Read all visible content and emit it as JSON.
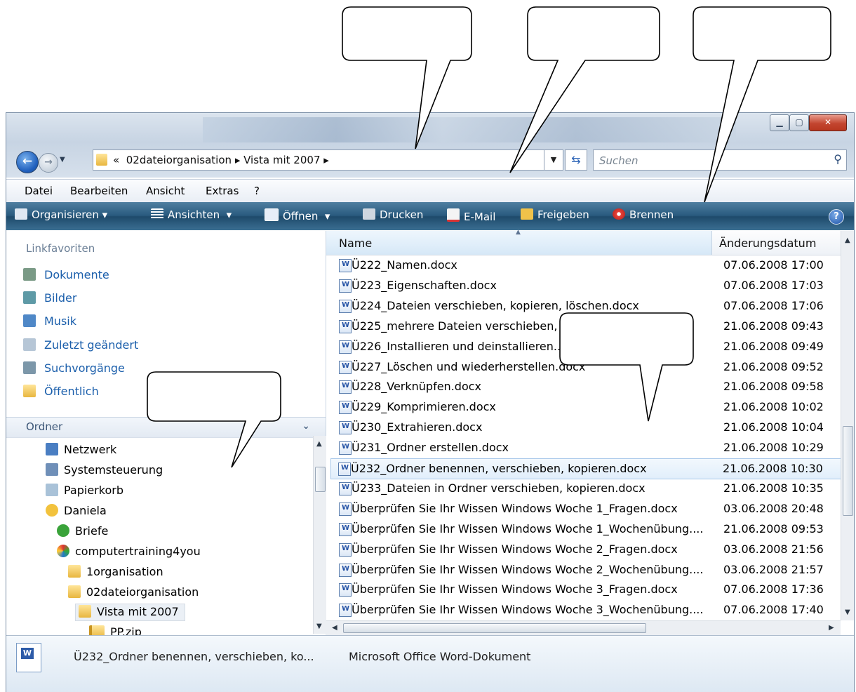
{
  "address": {
    "chevrons": "«",
    "segment1": "02dateiorganisation",
    "segment2": "Vista mit 2007",
    "separator": "▸"
  },
  "search": {
    "placeholder": "Suchen"
  },
  "menu": {
    "datei": "Datei",
    "bearbeiten": "Bearbeiten",
    "ansicht": "Ansicht",
    "extras": "Extras",
    "help": "?"
  },
  "toolbar": {
    "organisieren": "Organisieren",
    "ansichten": "Ansichten",
    "oeffnen": "Öffnen",
    "drucken": "Drucken",
    "email": "E-Mail",
    "freigeben": "Freigeben",
    "brennen": "Brennen",
    "help": "?"
  },
  "nav": {
    "favorites_header": "Linkfavoriten",
    "favorites": [
      "Dokumente",
      "Bilder",
      "Musik",
      "Zuletzt geändert",
      "Suchvorgänge",
      "Öffentlich"
    ],
    "folders_header": "Ordner",
    "tree": [
      "Netzwerk",
      "Systemsteuerung",
      "Papierkorb",
      "Daniela",
      "Briefe",
      "computertraining4you",
      "1organisation",
      "02dateiorganisation",
      "Vista mit 2007",
      "PP.zip"
    ]
  },
  "columns": {
    "name": "Name",
    "date": "Änderungsdatum"
  },
  "files": [
    {
      "name": "Ü222_Namen.docx",
      "date": "07.06.2008 17:00"
    },
    {
      "name": "Ü223_Eigenschaften.docx",
      "date": "07.06.2008 17:03"
    },
    {
      "name": "Ü224_Dateien verschieben, kopieren, löschen.docx",
      "date": "07.06.2008 17:06"
    },
    {
      "name": "Ü225_mehrere Dateien verschieben, ...",
      "date": "21.06.2008 09:43"
    },
    {
      "name": "Ü226_Installieren und deinstallieren....",
      "date": "21.06.2008 09:49"
    },
    {
      "name": "Ü227_Löschen und wiederherstellen.docx",
      "date": "21.06.2008 09:52"
    },
    {
      "name": "Ü228_Verknüpfen.docx",
      "date": "21.06.2008 09:58"
    },
    {
      "name": "Ü229_Komprimieren.docx",
      "date": "21.06.2008 10:02"
    },
    {
      "name": "Ü230_Extrahieren.docx",
      "date": "21.06.2008 10:04"
    },
    {
      "name": "Ü231_Ordner erstellen.docx",
      "date": "21.06.2008 10:29"
    },
    {
      "name": "Ü232_Ordner benennen, verschieben, kopieren.docx",
      "date": "21.06.2008 10:30"
    },
    {
      "name": "Ü233_Dateien in Ordner verschieben, kopieren.docx",
      "date": "21.06.2008 10:35"
    },
    {
      "name": "Überprüfen Sie Ihr Wissen Windows Woche 1_Fragen.docx",
      "date": "03.06.2008 20:48"
    },
    {
      "name": "Überprüfen Sie Ihr Wissen Windows Woche 1_Wochenübung....",
      "date": "21.06.2008 09:53"
    },
    {
      "name": "Überprüfen Sie Ihr Wissen Windows Woche 2_Fragen.docx",
      "date": "03.06.2008 21:56"
    },
    {
      "name": "Überprüfen Sie Ihr Wissen Windows Woche 2_Wochenübung....",
      "date": "03.06.2008 21:57"
    },
    {
      "name": "Überprüfen Sie Ihr Wissen Windows Woche 3_Fragen.docx",
      "date": "07.06.2008 17:36"
    },
    {
      "name": "Überprüfen Sie Ihr Wissen Windows Woche 3_Wochenübung....",
      "date": "07.06.2008 17:40"
    }
  ],
  "details": {
    "name": "Ü232_Ordner benennen, verschieben, ko...",
    "type": "Microsoft Office Word-Dokument"
  },
  "colors": {
    "toolbar": "#295a7e",
    "link": "#1a5eab",
    "selection": "#e1eefb"
  }
}
